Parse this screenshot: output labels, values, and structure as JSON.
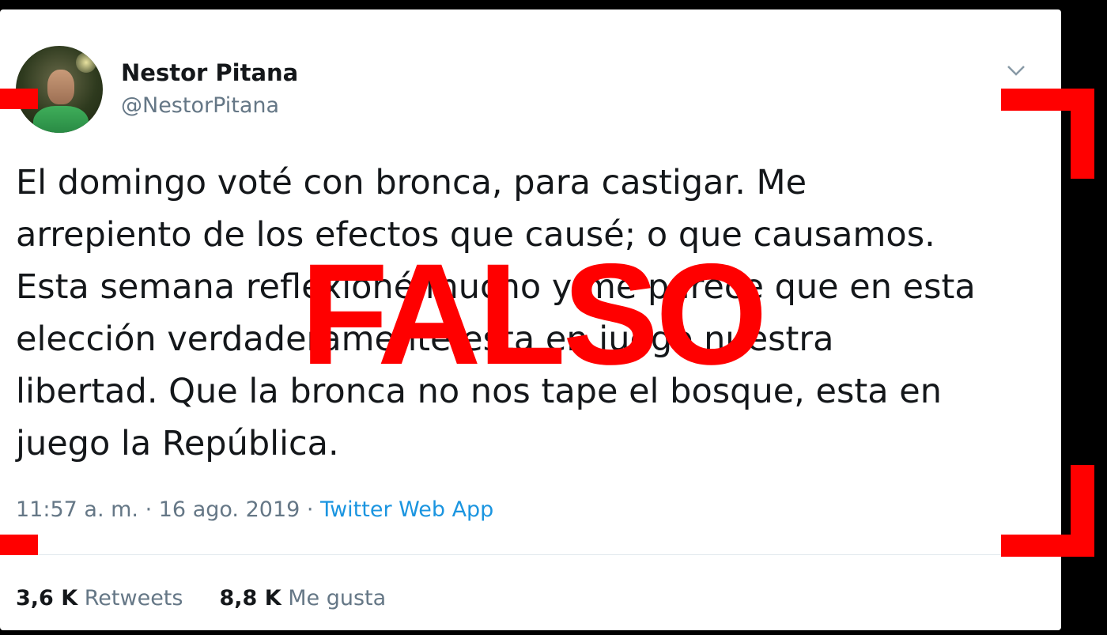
{
  "tweet": {
    "display_name": "Nestor Pitana",
    "handle": "@NestorPitana",
    "text": "El domingo voté con bronca, para castigar. Me\narrepiento de los efectos que causé; o que causamos.\nEsta semana reflexioné mucho y me parece que en esta\nelección verdaderamente esta en juego nuestra\nlibertad.  Que la bronca no nos tape el bosque, esta en\njuego la República.",
    "time": "11:57 a. m.",
    "date": "16 ago. 2019",
    "separator": " · ",
    "app": "Twitter Web App",
    "retweets_count": "3,6 K",
    "retweets_label": "Retweets",
    "likes_count": "8,8 K",
    "likes_label": "Me gusta",
    "menu_icon": "chevron-down-icon"
  },
  "stamp": {
    "label": "FALSO",
    "color": "#ff0000"
  },
  "colors": {
    "link": "#1b95e0",
    "muted": "#657786",
    "text": "#14171a"
  }
}
